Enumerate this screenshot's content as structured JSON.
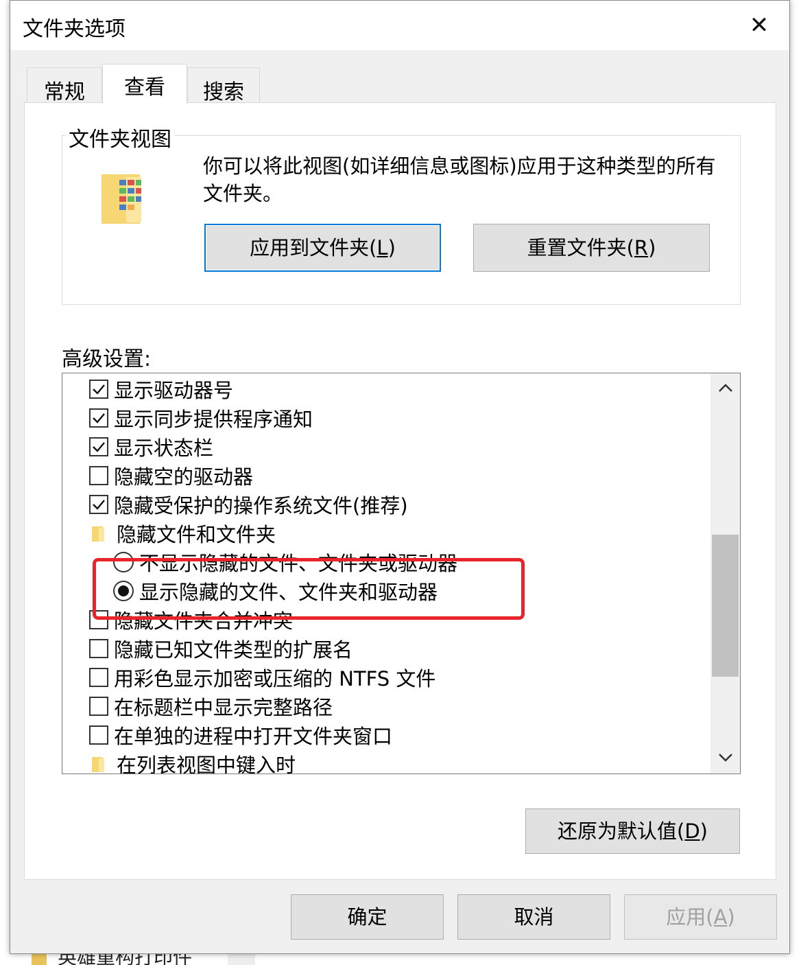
{
  "dialog": {
    "title": "文件夹选项",
    "close_glyph": "✕"
  },
  "tabs": [
    {
      "label": "常规",
      "active": false
    },
    {
      "label": "查看",
      "active": true
    },
    {
      "label": "搜索",
      "active": false
    }
  ],
  "folder_views": {
    "legend": "文件夹视图",
    "description": "你可以将此视图(如详细信息或图标)应用于这种类型的所有文件夹。",
    "apply_button": {
      "text": "应用到文件夹(",
      "key": "L",
      "close": ")"
    },
    "reset_button": {
      "text": "重置文件夹(",
      "key": "R",
      "close": ")"
    }
  },
  "advanced": {
    "label": "高级设置:",
    "items": [
      {
        "type": "checkbox",
        "checked": true,
        "label": "显示驱动器号"
      },
      {
        "type": "checkbox",
        "checked": true,
        "label": "显示同步提供程序通知"
      },
      {
        "type": "checkbox",
        "checked": true,
        "label": "显示状态栏"
      },
      {
        "type": "checkbox",
        "checked": false,
        "label": "隐藏空的驱动器"
      },
      {
        "type": "checkbox",
        "checked": true,
        "label": "隐藏受保护的操作系统文件(推荐)"
      },
      {
        "type": "folder",
        "label": "隐藏文件和文件夹"
      },
      {
        "type": "radio",
        "checked": false,
        "label": "不显示隐藏的文件、文件夹或驱动器"
      },
      {
        "type": "radio",
        "checked": true,
        "label": "显示隐藏的文件、文件夹和驱动器"
      },
      {
        "type": "checkbox",
        "checked": false,
        "label": "隐藏文件夹合并冲突"
      },
      {
        "type": "checkbox",
        "checked": false,
        "label": "隐藏已知文件类型的扩展名"
      },
      {
        "type": "checkbox",
        "checked": false,
        "label": "用彩色显示加密或压缩的 NTFS 文件"
      },
      {
        "type": "checkbox",
        "checked": false,
        "label": "在标题栏中显示完整路径"
      },
      {
        "type": "checkbox",
        "checked": false,
        "label": "在单独的进程中打开文件夹窗口"
      },
      {
        "type": "folder",
        "label": "在列表视图中键入时"
      }
    ],
    "restore_button": {
      "text": "还原为默认值(",
      "key": "D",
      "close": ")"
    }
  },
  "footer": {
    "ok": "确定",
    "cancel": "取消",
    "apply": {
      "text": "应用(",
      "key": "A",
      "close": ")"
    }
  },
  "background": {
    "bottom_item": "英雄重构打印件"
  },
  "colors": {
    "highlight": "#e8252b",
    "focus": "#0078d7"
  }
}
